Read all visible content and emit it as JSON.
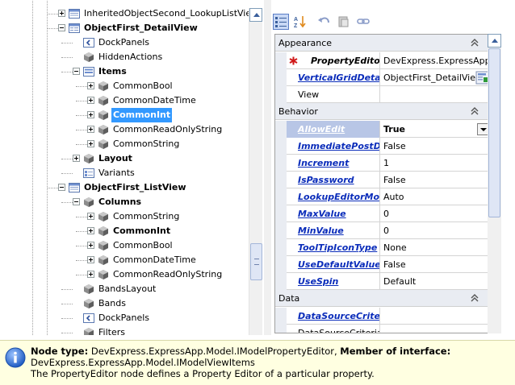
{
  "tree": {
    "rows": [
      {
        "label": "InheritedObjectSecond_LookupListView",
        "bold": false,
        "level": 1,
        "expander": "plus",
        "icon": "listview-icon"
      },
      {
        "label": "ObjectFirst_DetailView",
        "bold": true,
        "level": 1,
        "expander": "minus",
        "icon": "detailview-icon"
      },
      {
        "label": "DockPanels",
        "bold": false,
        "level": 2,
        "expander": "none",
        "icon": "dockpanels-icon"
      },
      {
        "label": "HiddenActions",
        "bold": false,
        "level": 2,
        "expander": "none",
        "icon": "cube-icon"
      },
      {
        "label": "Items",
        "bold": true,
        "level": 2,
        "expander": "minus",
        "icon": "items-icon"
      },
      {
        "label": "CommonBool",
        "bold": false,
        "level": 3,
        "expander": "plus",
        "icon": "cube-icon"
      },
      {
        "label": "CommonDateTime",
        "bold": false,
        "level": 3,
        "expander": "plus",
        "icon": "cube-icon"
      },
      {
        "label": "CommonInt",
        "bold": true,
        "level": 3,
        "expander": "plus",
        "icon": "cube-icon",
        "selected": true
      },
      {
        "label": "CommonReadOnlyString",
        "bold": false,
        "level": 3,
        "expander": "plus",
        "icon": "cube-icon"
      },
      {
        "label": "CommonString",
        "bold": false,
        "level": 3,
        "expander": "plus",
        "icon": "cube-icon"
      },
      {
        "label": "Layout",
        "bold": true,
        "level": 2,
        "expander": "plus",
        "icon": "cube-icon"
      },
      {
        "label": "Variants",
        "bold": false,
        "level": 2,
        "expander": "none",
        "icon": "variants-icon"
      },
      {
        "label": "ObjectFirst_ListView",
        "bold": true,
        "level": 1,
        "expander": "minus",
        "icon": "listview-icon"
      },
      {
        "label": "Columns",
        "bold": true,
        "level": 2,
        "expander": "minus",
        "icon": "cube-icon"
      },
      {
        "label": "CommonString",
        "bold": false,
        "level": 3,
        "expander": "plus",
        "icon": "cube-icon"
      },
      {
        "label": "CommonInt",
        "bold": true,
        "level": 3,
        "expander": "plus",
        "icon": "cube-icon"
      },
      {
        "label": "CommonBool",
        "bold": false,
        "level": 3,
        "expander": "plus",
        "icon": "cube-icon"
      },
      {
        "label": "CommonDateTime",
        "bold": false,
        "level": 3,
        "expander": "plus",
        "icon": "cube-icon"
      },
      {
        "label": "CommonReadOnlyString",
        "bold": false,
        "level": 3,
        "expander": "plus",
        "icon": "cube-icon"
      },
      {
        "label": "BandsLayout",
        "bold": false,
        "level": 2,
        "expander": "none",
        "icon": "cube-icon"
      },
      {
        "label": "Bands",
        "bold": false,
        "level": 2,
        "expander": "none",
        "icon": "cube-icon"
      },
      {
        "label": "DockPanels",
        "bold": false,
        "level": 2,
        "expander": "none",
        "icon": "dockpanels-icon"
      },
      {
        "label": "Filters",
        "bold": false,
        "level": 2,
        "expander": "none",
        "icon": "cube-icon"
      }
    ]
  },
  "toolbar": {
    "buttons": [
      {
        "name": "categorized-button",
        "icon": "categorized-icon",
        "active": true
      },
      {
        "name": "alphabetical-button",
        "icon": "sort-az-icon",
        "active": false
      },
      {
        "name": "undo-button",
        "icon": "undo-icon",
        "active": false
      },
      {
        "name": "delete-button",
        "icon": "delete-icon",
        "active": false
      },
      {
        "name": "link-button",
        "icon": "link-icon",
        "active": false
      }
    ]
  },
  "property_grid": {
    "categories": [
      {
        "name": "Appearance",
        "rows": [
          {
            "name": "PropertyEditor",
            "value": "DevExpress.ExpressApp.Win.Editors.IntegerPropertyEditor",
            "style": "req",
            "required": true
          },
          {
            "name": "VerticalGridDetailView",
            "value": "ObjectFirst_DetailView",
            "style": "link",
            "editor_button": true
          },
          {
            "name": "View",
            "value": "",
            "style": "plain"
          }
        ]
      },
      {
        "name": "Behavior",
        "rows": [
          {
            "name": "AllowEdit",
            "value": "True",
            "style": "link-focus",
            "value_bold": true,
            "dropdown": true
          },
          {
            "name": "ImmediatePostData",
            "value": "False",
            "style": "link"
          },
          {
            "name": "Increment",
            "value": "1",
            "style": "link"
          },
          {
            "name": "IsPassword",
            "value": "False",
            "style": "link"
          },
          {
            "name": "LookupEditorMode",
            "value": "Auto",
            "style": "link"
          },
          {
            "name": "MaxValue",
            "value": "0",
            "style": "link"
          },
          {
            "name": "MinValue",
            "value": "0",
            "style": "link"
          },
          {
            "name": "ToolTipIconType",
            "value": "None",
            "style": "link"
          },
          {
            "name": "UseDefaultValue",
            "value": "False",
            "style": "link"
          },
          {
            "name": "UseSpin",
            "value": "Default",
            "style": "link"
          }
        ]
      },
      {
        "name": "Data",
        "rows": [
          {
            "name": "DataSourceCriteria",
            "value": "",
            "style": "link"
          },
          {
            "name": "DataSourceCriteriaProperty",
            "value": "",
            "style": "plain"
          }
        ]
      }
    ]
  },
  "description": {
    "node_type_label": "Node type:",
    "node_type_value": " DevExpress.ExpressApp.Model.IModelPropertyEditor, ",
    "member_label": "Member of interface:",
    "member_value": "DevExpress.ExpressApp.Model.IModelViewItems",
    "summary": "The PropertyEditor node defines a Property Editor of a particular property."
  },
  "colors": {
    "selection": "#3399ff",
    "link": "#0a2cba",
    "category_bg": "#e9ecf2",
    "description_bg": "#ffffe1"
  }
}
